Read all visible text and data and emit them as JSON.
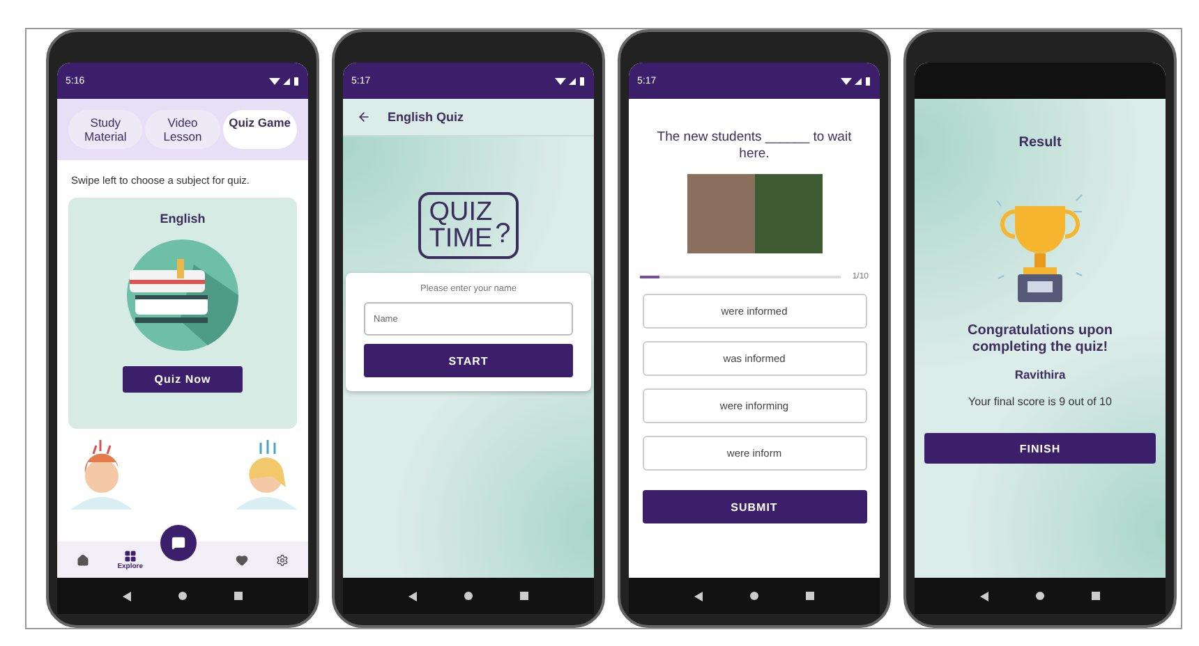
{
  "screens": [
    {
      "kind": "subjects",
      "status_time": "5:16",
      "tabs": [
        {
          "label": "Study Material",
          "selected": false
        },
        {
          "label": "Video Lesson",
          "selected": false
        },
        {
          "label": "Quiz Game",
          "selected": true
        }
      ],
      "hint": "Swipe left to choose a subject for quiz.",
      "subject": "English",
      "button": "Quiz Now",
      "bottom_nav": [
        {
          "kind": "home",
          "selected": false
        },
        {
          "kind": "grid",
          "label": "Explore",
          "selected": true
        },
        {
          "kind": "heart",
          "selected": false
        },
        {
          "kind": "gear",
          "selected": false
        }
      ]
    },
    {
      "kind": "name_entry",
      "status_time": "5:17",
      "title": "English Quiz",
      "logo": {
        "lines": [
          "QUIZ",
          "TIME"
        ],
        "mark": "?"
      },
      "prompt": "Please enter your name",
      "field": {
        "placeholder": "Name"
      },
      "button": "START"
    },
    {
      "kind": "question",
      "status_time": "5:17",
      "question": "The new students ______ to wait here.",
      "progress": {
        "level": 0.1,
        "counter": "1/10"
      },
      "options": [
        "were informed",
        "was informed",
        "were informing",
        "were inform"
      ],
      "button": "SUBMIT"
    },
    {
      "kind": "result",
      "title": "Result",
      "heading": "Congratulations upon completing the quiz!",
      "name": "Ravithira",
      "score": "Your final score is 9 out of 10",
      "button": "FINISH"
    }
  ]
}
